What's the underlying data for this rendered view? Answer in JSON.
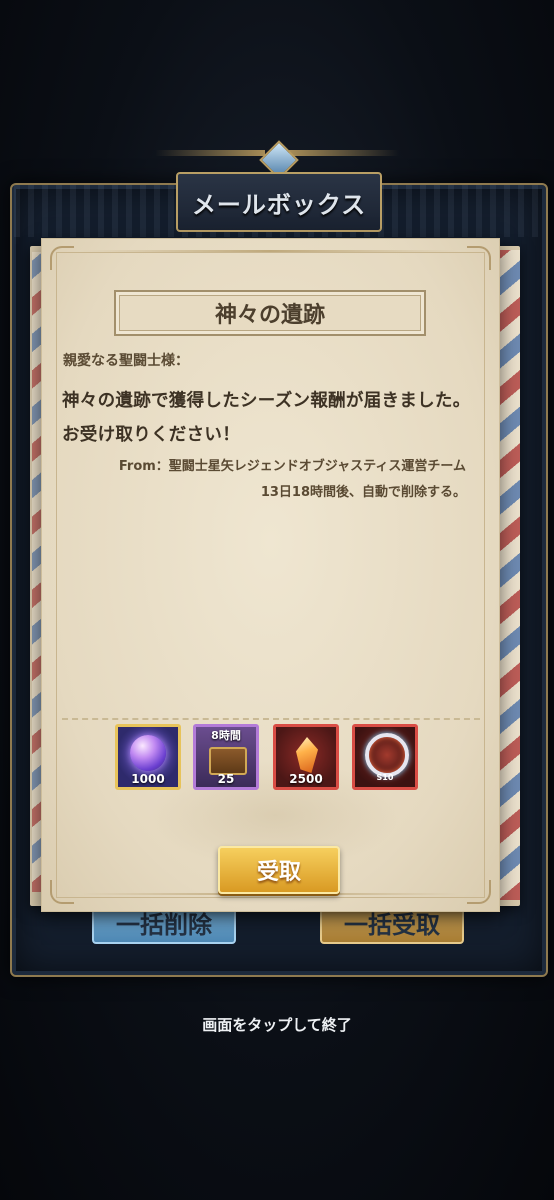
{
  "window": {
    "title": "メールボックス"
  },
  "background_buttons": {
    "delete_all": "一括削除",
    "claim_all": "一括受取"
  },
  "mail": {
    "subject": "神々の遺跡",
    "salutation": "親愛なる聖闘士様：",
    "body": "神々の遺跡で獲得したシーズン報酬が届きました。お受け取りください！",
    "from": "From：聖闘士星矢レジェンドオブジャスティス運営チーム",
    "expiry": "13日18時間後、自動で削除する。"
  },
  "rewards": [
    {
      "icon": "cosmo-orb-icon",
      "quantity": "1000",
      "border_color": "#e7c35a"
    },
    {
      "icon": "treasure-chest-icon",
      "timer": "8時間",
      "quantity": "25",
      "border_color": "#b37bd8"
    },
    {
      "icon": "fire-crystal-icon",
      "quantity": "2500",
      "border_color": "#d94d45"
    },
    {
      "icon": "season-badge-icon",
      "badge_label": "S10",
      "border_color": "#d94d45"
    }
  ],
  "actions": {
    "claim_label": "受取"
  },
  "hint": "画面をタップして終了",
  "colors": {
    "accent_gold": "#d99a23",
    "paper": "#e9dfc8"
  }
}
